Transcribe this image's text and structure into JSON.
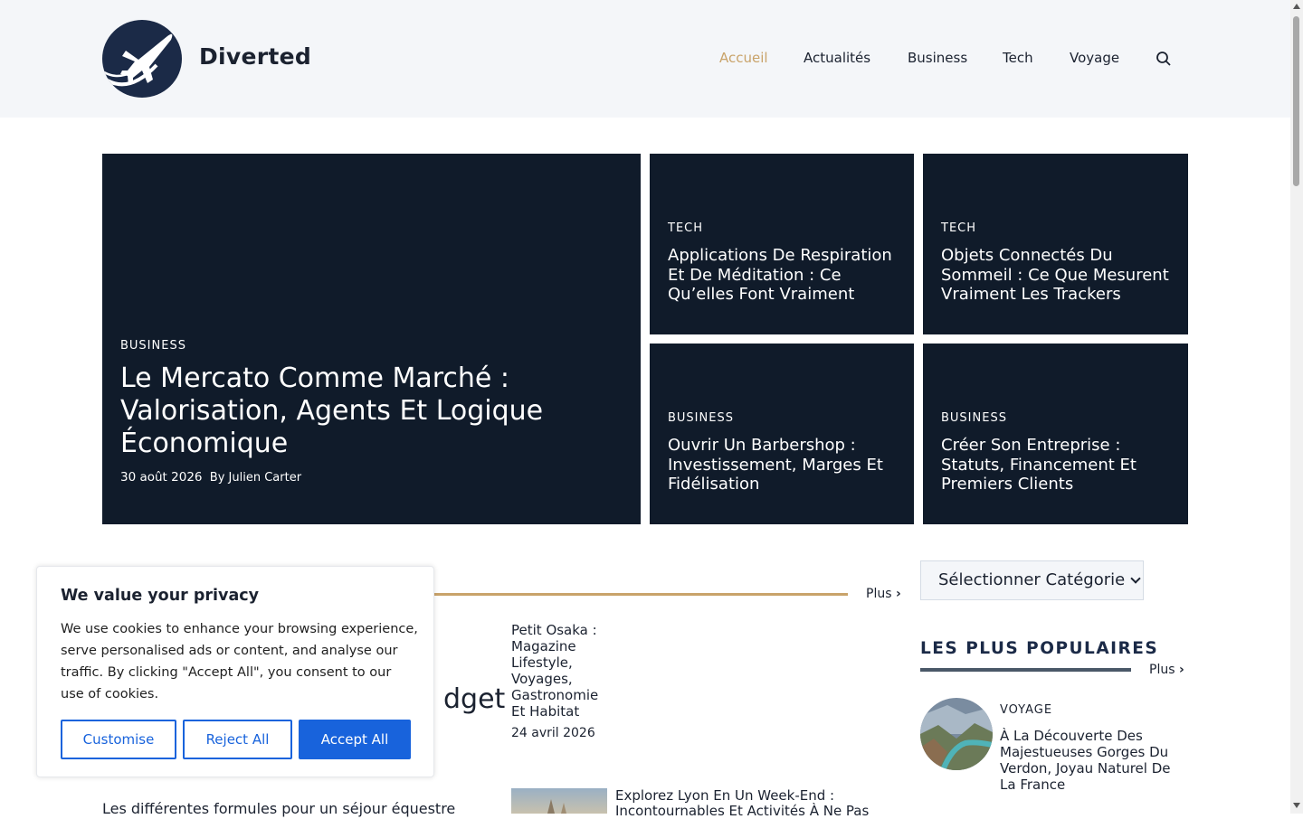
{
  "site": {
    "name": "Diverted"
  },
  "nav": {
    "items": [
      "Accueil",
      "Actualités",
      "Business",
      "Tech",
      "Voyage"
    ],
    "active": "Accueil"
  },
  "featured": {
    "main": {
      "category": "BUSINESS",
      "title": "Le Mercato Comme Marché : Valorisation, Agents Et Logique Économique",
      "date": "30 août 2026",
      "by": "By Julien Carter"
    },
    "cards": [
      {
        "category": "TECH",
        "title": "Applications De Respiration Et De Méditation : Ce Qu’elles Font Vraiment"
      },
      {
        "category": "TECH",
        "title": "Objets Connectés Du Sommeil : Ce Que Mesurent Vraiment Les Trackers"
      },
      {
        "category": "BUSINESS",
        "title": "Ouvrir Un Barbershop : Investissement, Marges Et Fidélisation"
      },
      {
        "category": "BUSINESS",
        "title": "Créer Son Entreprise : Statuts, Financement Et Premiers Clients"
      }
    ]
  },
  "section": {
    "more": "Plus"
  },
  "articles": {
    "partial_title": "dget",
    "excerpt": "Les différentes formules pour un séjour équestre",
    "side1": {
      "title": "Petit Osaka : Magazine Lifestyle, Voyages, Gastronomie Et Habitat",
      "date": "24 avril 2026"
    },
    "side2": {
      "title": "Explorez Lyon En Un Week-End : Incontournables Et Activités À Ne Pas"
    }
  },
  "sidebar": {
    "select_label": "Sélectionner Catégorie",
    "popular_title": "LES PLUS POPULAIRES",
    "more": "Plus",
    "popular_item": {
      "category": "VOYAGE",
      "title": "À La Découverte Des Majestueuses Gorges Du Verdon, Joyau Naturel De La France"
    }
  },
  "cookie": {
    "title": "We value your privacy",
    "text": "We use cookies to enhance your browsing experience, serve personalised ads or content, and analyse our traffic. By clicking \"Accept All\", you consent to our use of cookies.",
    "customise": "Customise",
    "reject": "Reject All",
    "accept": "Accept All"
  },
  "colors": {
    "accent": "#c9a36a",
    "card_bg": "#101b2a",
    "button_blue": "#1863dc",
    "header_bg": "#f4f6f9"
  }
}
